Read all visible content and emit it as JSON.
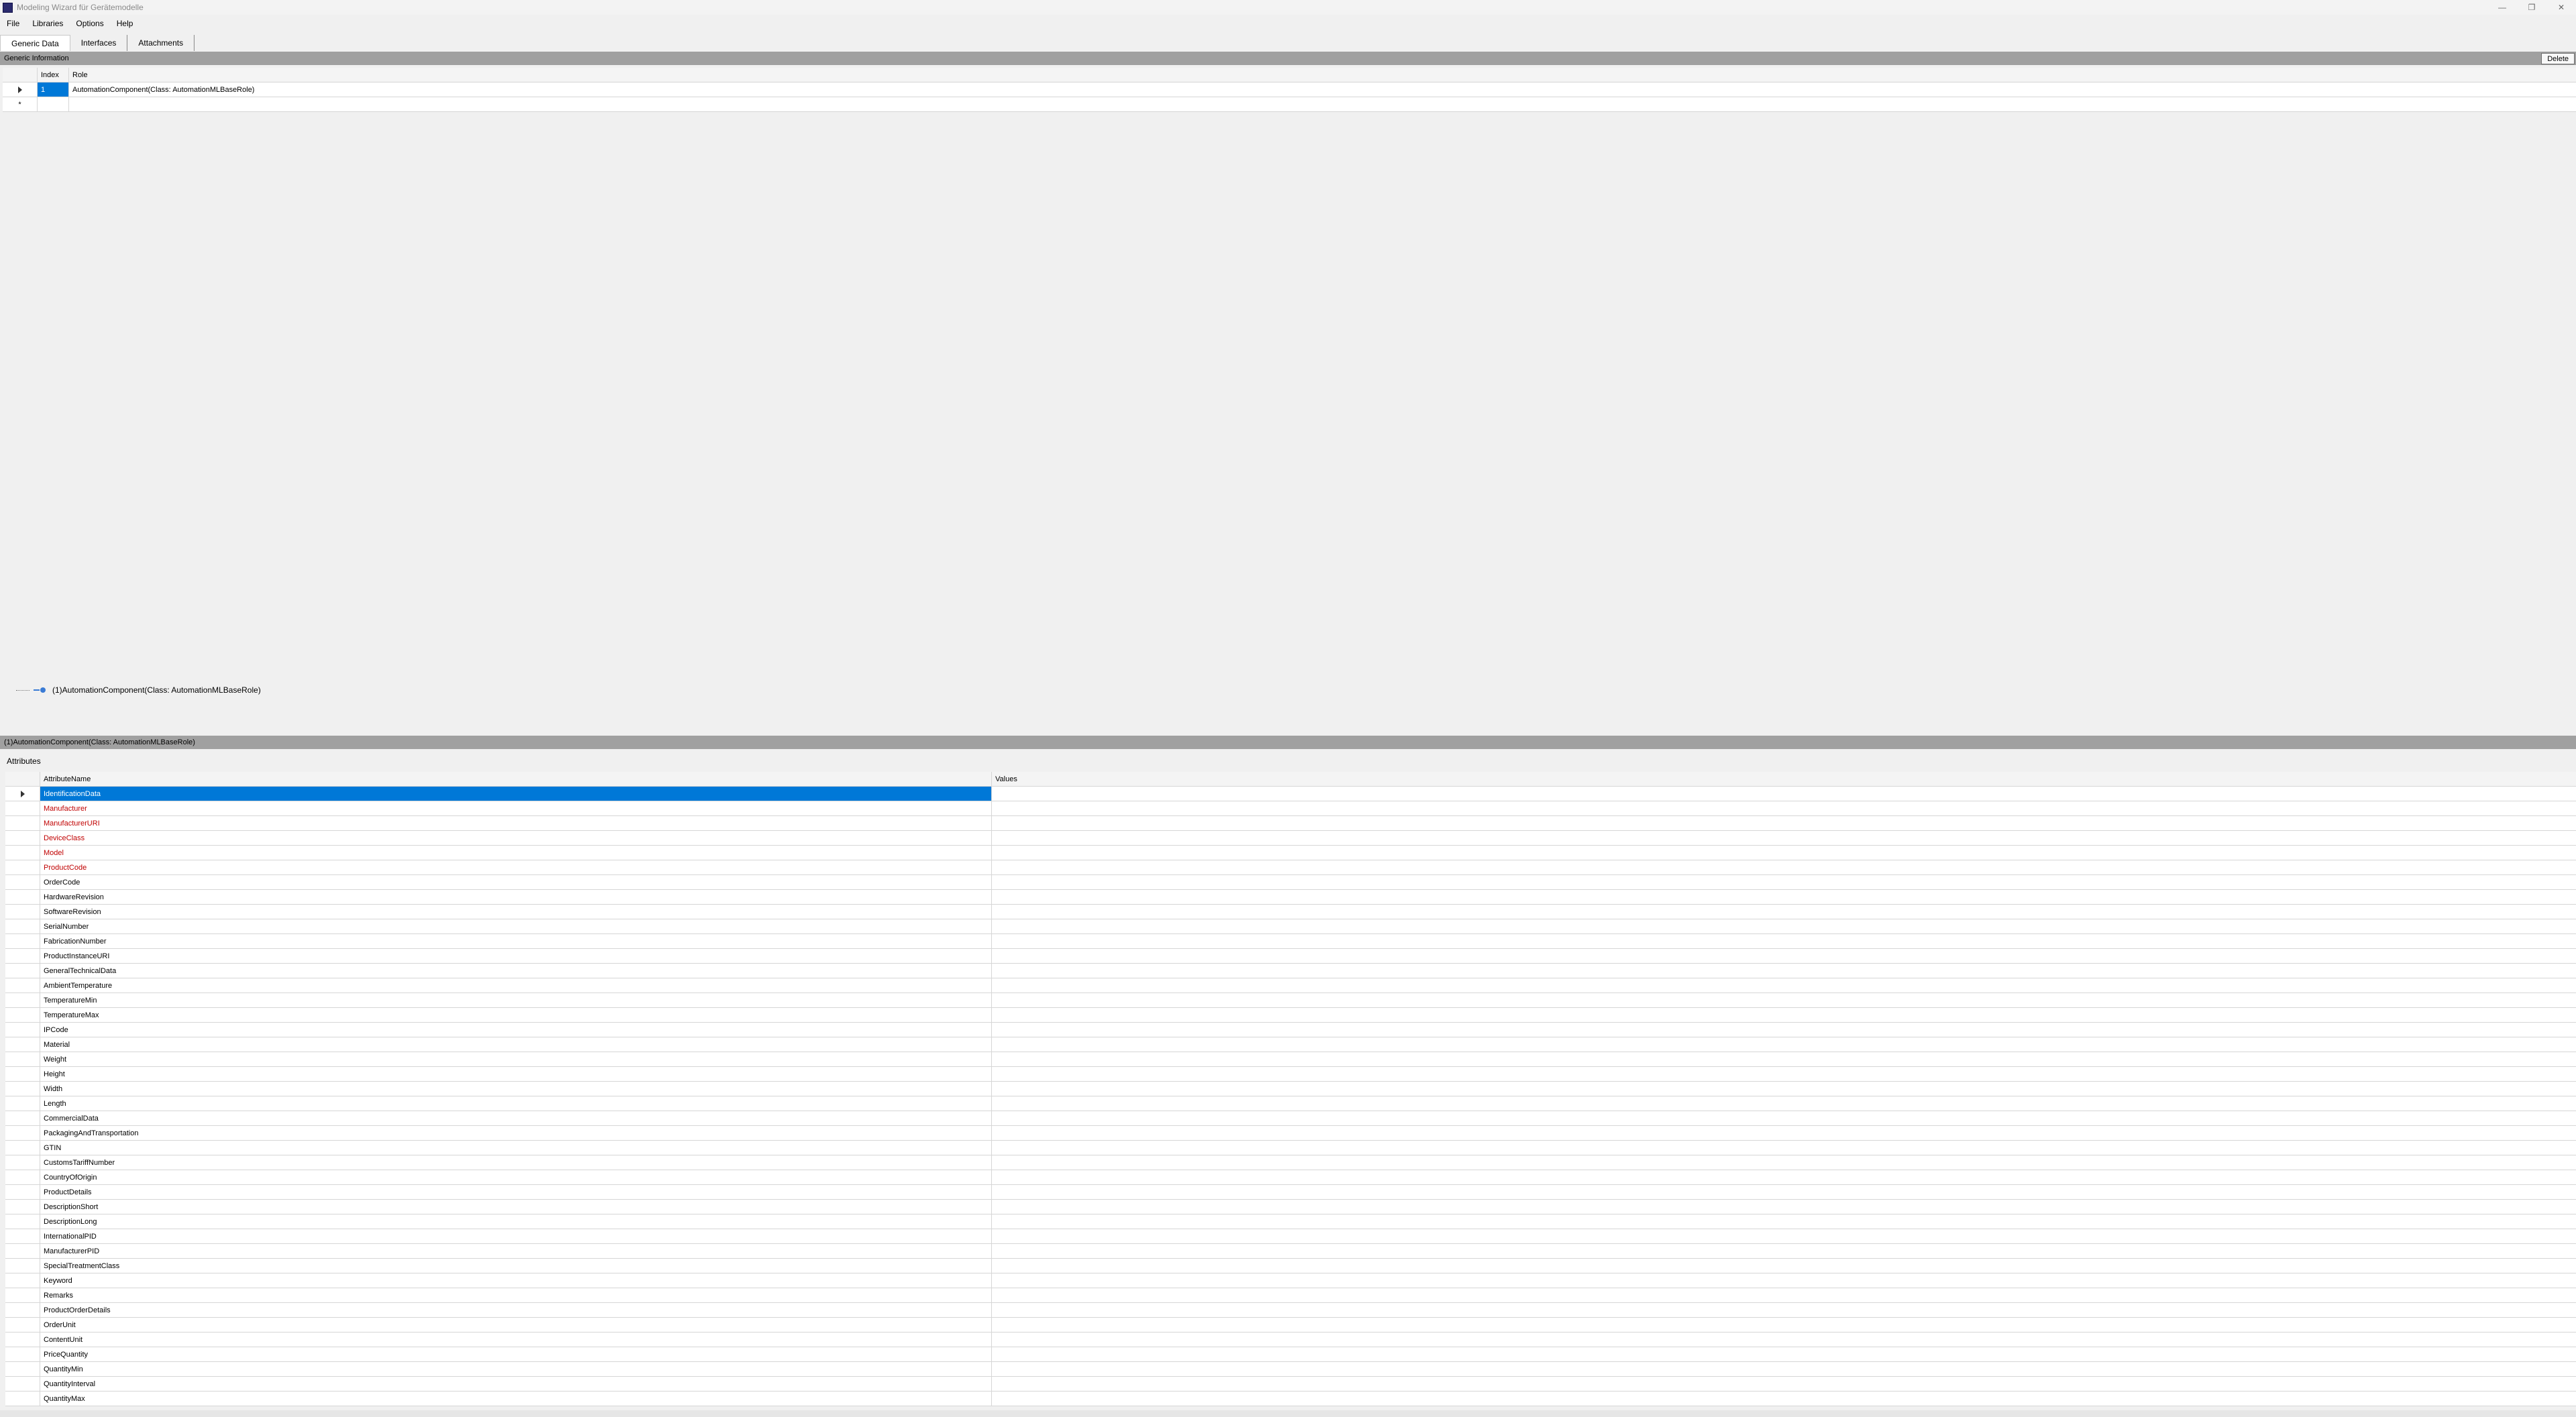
{
  "window": {
    "title": "Modeling Wizard für Gerätemodelle",
    "controls": {
      "minimize": "—",
      "restore": "❐",
      "close": "✕"
    }
  },
  "menu": [
    "File",
    "Libraries",
    "Options",
    "Help"
  ],
  "tabs": [
    {
      "label": "Generic Data",
      "active": true
    },
    {
      "label": "Interfaces",
      "active": false
    },
    {
      "label": "Attachments",
      "active": false
    }
  ],
  "generic_info": {
    "header": "Generic Information",
    "delete_label": "Delete",
    "columns": {
      "index": "Index",
      "role": "Role"
    },
    "rows": [
      {
        "index": "1",
        "role": "AutomationComponent(Class:  AutomationMLBaseRole)"
      }
    ],
    "new_row_marker": "*"
  },
  "tree": {
    "item_label": "(1)AutomationComponent(Class:  AutomationMLBaseRole)"
  },
  "detail": {
    "header": "(1)AutomationComponent(Class:  AutomationMLBaseRole)",
    "attributes_label": "Attributes",
    "columns": {
      "name": "AttributeName",
      "values": "Values"
    },
    "rows": [
      {
        "name": "IdentificationData",
        "selected": true,
        "required": false
      },
      {
        "name": "Manufacturer",
        "required": true
      },
      {
        "name": "ManufacturerURI",
        "required": true
      },
      {
        "name": "DeviceClass",
        "required": true
      },
      {
        "name": "Model",
        "required": true
      },
      {
        "name": "ProductCode",
        "required": true
      },
      {
        "name": "OrderCode"
      },
      {
        "name": "HardwareRevision"
      },
      {
        "name": "SoftwareRevision"
      },
      {
        "name": "SerialNumber"
      },
      {
        "name": "FabricationNumber"
      },
      {
        "name": "ProductInstanceURI"
      },
      {
        "name": "GeneralTechnicalData"
      },
      {
        "name": "AmbientTemperature"
      },
      {
        "name": "TemperatureMin"
      },
      {
        "name": "TemperatureMax"
      },
      {
        "name": "IPCode"
      },
      {
        "name": "Material"
      },
      {
        "name": "Weight"
      },
      {
        "name": "Height"
      },
      {
        "name": "Width"
      },
      {
        "name": "Length"
      },
      {
        "name": "CommercialData"
      },
      {
        "name": "PackagingAndTransportation"
      },
      {
        "name": "GTIN"
      },
      {
        "name": "CustomsTariffNumber"
      },
      {
        "name": "CountryOfOrigin"
      },
      {
        "name": "ProductDetails"
      },
      {
        "name": "DescriptionShort"
      },
      {
        "name": "DescriptionLong"
      },
      {
        "name": "InternationalPID"
      },
      {
        "name": "ManufacturerPID"
      },
      {
        "name": "SpecialTreatmentClass"
      },
      {
        "name": "Keyword"
      },
      {
        "name": "Remarks"
      },
      {
        "name": "ProductOrderDetails"
      },
      {
        "name": "OrderUnit"
      },
      {
        "name": "ContentUnit"
      },
      {
        "name": "PriceQuantity"
      },
      {
        "name": "QuantityMin"
      },
      {
        "name": "QuantityInterval"
      },
      {
        "name": "QuantityMax"
      }
    ]
  },
  "colors": {
    "selection": "#0078d7",
    "required_text": "#c00000",
    "section_header": "#a0a0a0"
  }
}
